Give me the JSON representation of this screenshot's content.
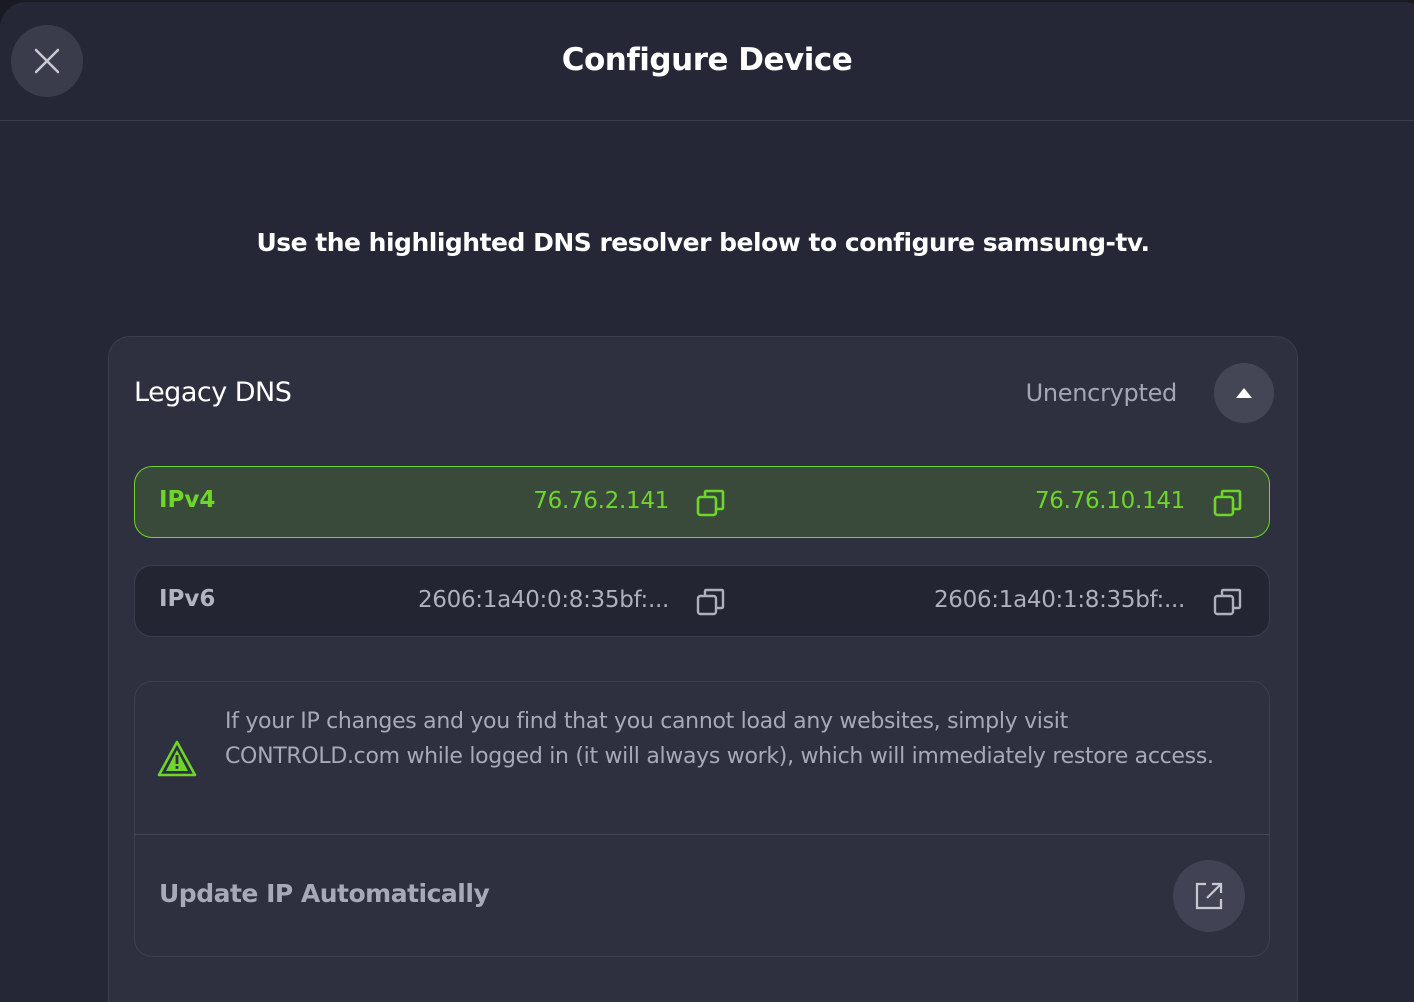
{
  "header": {
    "title": "Configure Device",
    "close_icon": "close-icon"
  },
  "instruction": "Use the highlighted DNS resolver below to configure samsung-tv.",
  "dns_card": {
    "title": "Legacy DNS",
    "status": "Unencrypted",
    "collapse_icon": "chevron-up-icon",
    "rows": [
      {
        "label": "IPv4",
        "primary": "76.76.2.141",
        "secondary": "76.76.10.141",
        "highlighted": true
      },
      {
        "label": "IPv6",
        "primary": "2606:1a40:0:8:35bf:...",
        "secondary": "2606:1a40:1:8:35bf:...",
        "highlighted": false
      }
    ],
    "copy_icon": "copy-icon"
  },
  "notice": {
    "icon": "warning-icon",
    "text": "If your IP changes and you find that you cannot load any websites, simply visit CONTROLD.com while logged in (it will always work), which will immediately restore access.",
    "update_label": "Update IP Automatically",
    "update_icon": "external-link-icon"
  },
  "colors": {
    "accent": "#6dd52b",
    "background": "#252736",
    "card": "#2e303f",
    "highlight_row": "#3a4a3a"
  }
}
